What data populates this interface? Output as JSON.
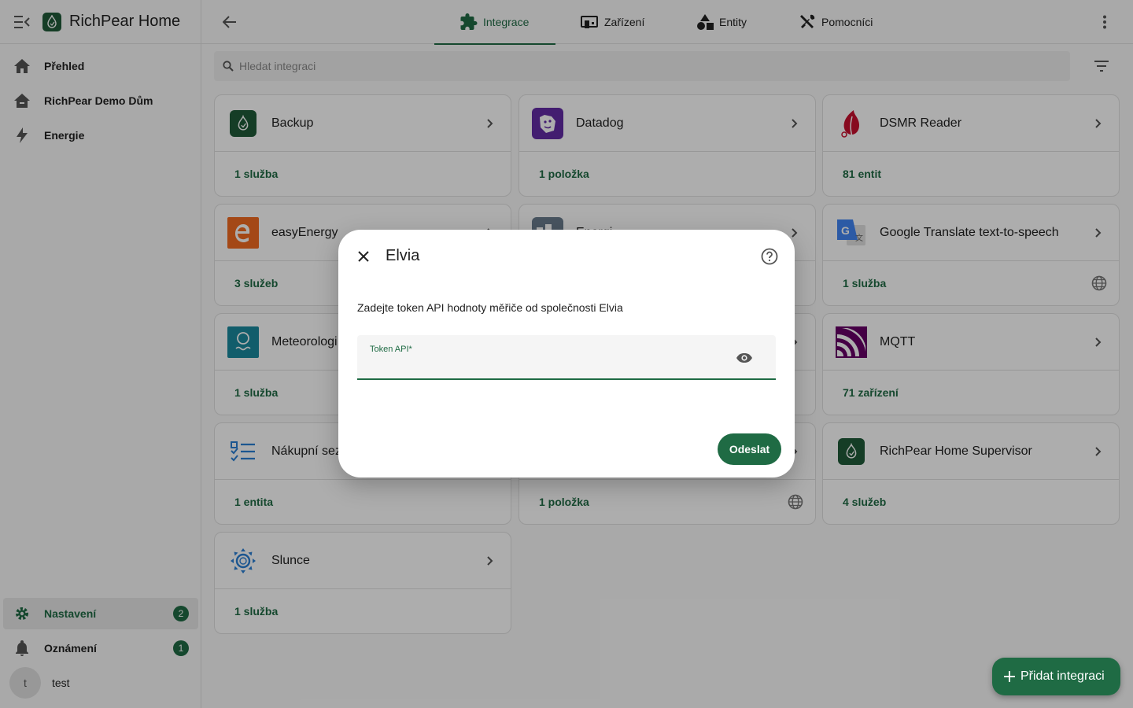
{
  "app": {
    "title": "RichPear Home"
  },
  "sidebar": {
    "items": [
      {
        "label": "Přehled",
        "icon": "home-icon"
      },
      {
        "label": "RichPear Demo Dům",
        "icon": "home-outline-icon"
      },
      {
        "label": "Energie",
        "icon": "lightning-icon"
      }
    ],
    "settings": {
      "label": "Nastavení",
      "badge": "2",
      "icon": "gear-icon"
    },
    "notifications": {
      "label": "Oznámení",
      "badge": "1",
      "icon": "bell-icon"
    },
    "user": {
      "initial": "t",
      "name": "test"
    }
  },
  "tabs": [
    {
      "label": "Integrace",
      "icon": "puzzle-icon",
      "active": true
    },
    {
      "label": "Zařízení",
      "icon": "devices-icon",
      "active": false
    },
    {
      "label": "Entity",
      "icon": "shapes-icon",
      "active": false
    },
    {
      "label": "Pomocníci",
      "icon": "tools-icon",
      "active": false
    }
  ],
  "search": {
    "placeholder": "Hledat integraci"
  },
  "cards": [
    {
      "name": "Backup",
      "summary": "1 služba",
      "cloud": false
    },
    {
      "name": "Datadog",
      "summary": "1 položka",
      "cloud": false
    },
    {
      "name": "DSMR Reader",
      "summary": "81 entit",
      "cloud": false
    },
    {
      "name": "easyEnergy",
      "summary": "3 služeb",
      "cloud": false
    },
    {
      "name": "Energi",
      "summary": "",
      "cloud": false
    },
    {
      "name": "Google Translate text-to-speech",
      "summary": "1 služba",
      "cloud": true
    },
    {
      "name": "Meteorologi",
      "summary": "1 služba",
      "cloud": false
    },
    {
      "name": "",
      "summary": "",
      "cloud": false
    },
    {
      "name": "MQTT",
      "summary": "71 zařízení",
      "cloud": false
    },
    {
      "name": "Nákupní sez",
      "summary": "1 entita",
      "cloud": false
    },
    {
      "name": "",
      "summary": "1 položka",
      "cloud": true
    },
    {
      "name": "RichPear Home Supervisor",
      "summary": "4 služeb",
      "cloud": false
    },
    {
      "name": "Slunce",
      "summary": "1 služba",
      "cloud": false
    }
  ],
  "dialog": {
    "title": "Elvia",
    "description": "Zadejte token API hodnoty měřiče od společnosti Elvia",
    "field_label": "Token API*",
    "field_value": "",
    "submit_label": "Odeslat"
  },
  "fab": {
    "label": "Přidat integraci"
  },
  "colors": {
    "primary": "#1f6b44",
    "brand": "#1f5a38"
  }
}
